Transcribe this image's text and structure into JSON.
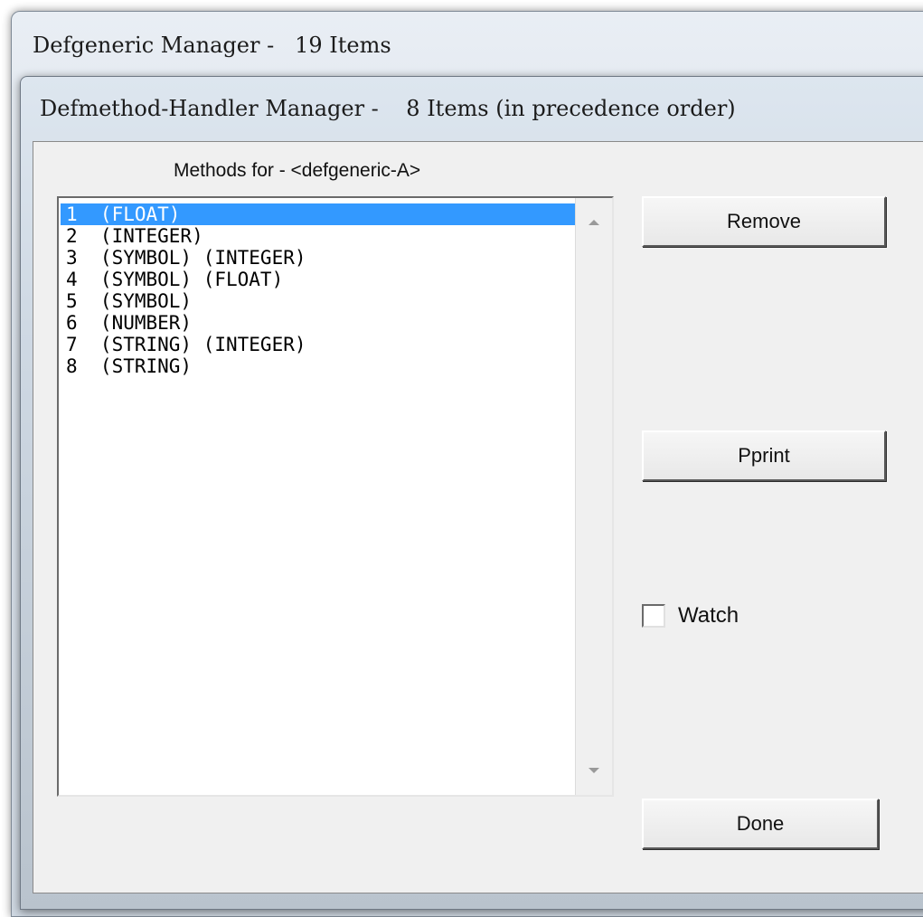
{
  "outer_window": {
    "title": "Defgeneric Manager -   19 Items"
  },
  "inner_window": {
    "title": "Defmethod-Handler Manager -    8 Items (in precedence order)"
  },
  "list": {
    "caption": "Methods for - <defgeneric-A>",
    "selected_index": 0,
    "items": [
      {
        "label": "1  (FLOAT)"
      },
      {
        "label": "2  (INTEGER)"
      },
      {
        "label": "3  (SYMBOL) (INTEGER)"
      },
      {
        "label": "4  (SYMBOL) (FLOAT)"
      },
      {
        "label": "5  (SYMBOL)"
      },
      {
        "label": "6  (NUMBER)"
      },
      {
        "label": "7  (STRING) (INTEGER)"
      },
      {
        "label": "8  (STRING)"
      }
    ]
  },
  "buttons": {
    "remove": "Remove",
    "pprint": "Pprint",
    "done": "Done"
  },
  "watch": {
    "label": "Watch",
    "checked": false
  },
  "colors": {
    "selection": "#3399ff",
    "dialog_background": "#f0f0f0"
  }
}
